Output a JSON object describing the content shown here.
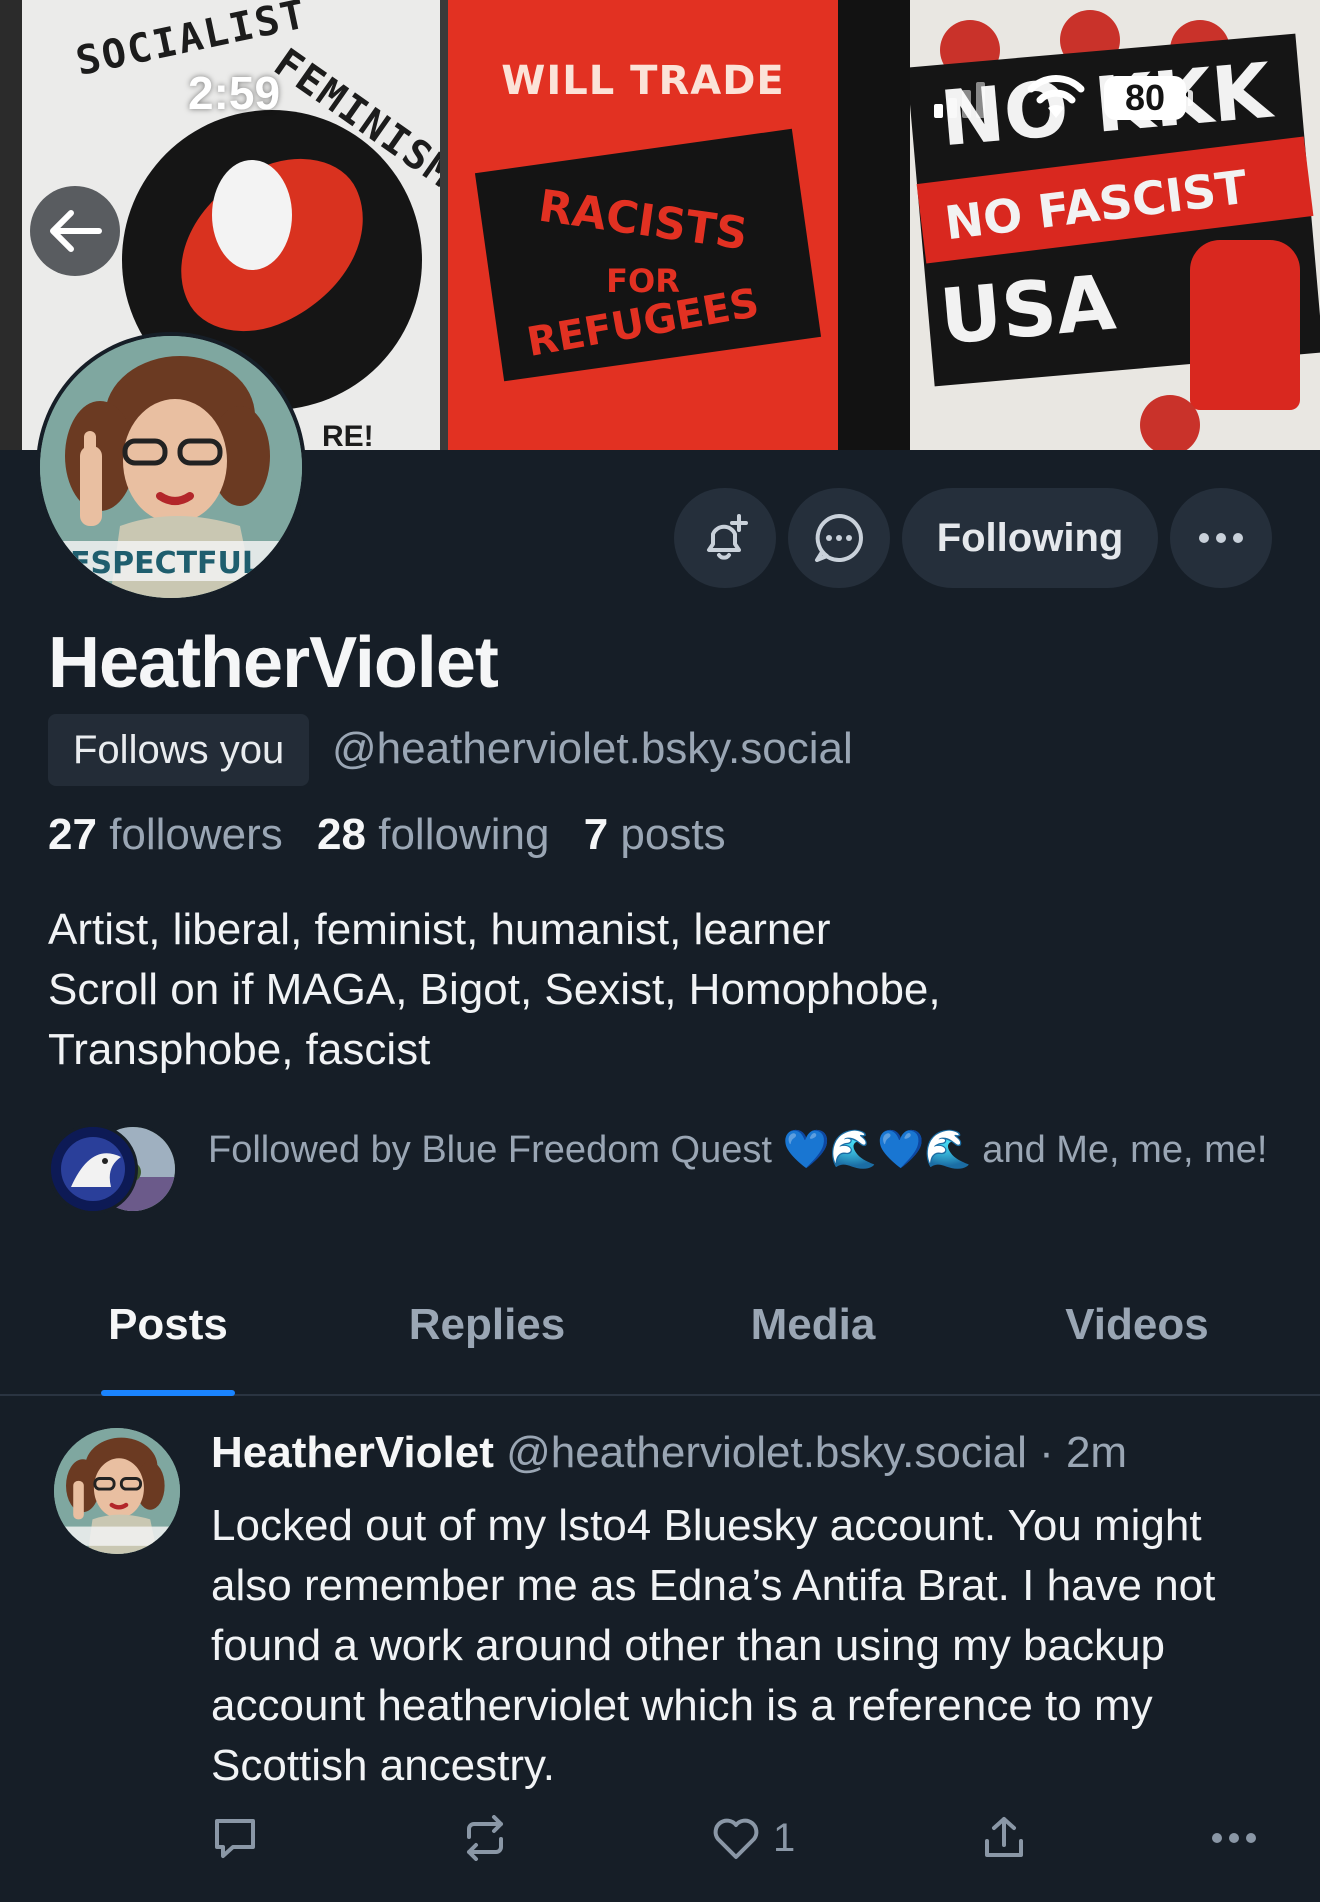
{
  "status_bar": {
    "time": "2:59",
    "battery": "80"
  },
  "banner": {
    "poster_left": {
      "line1": "SOCIALIST",
      "line2": "FEMINISM",
      "bottom": "RE!"
    },
    "poster_middle": {
      "line1": "WILL TRADE",
      "line2": "RACISTS",
      "line3": "FOR",
      "line4": "REFUGEES"
    },
    "poster_right": {
      "line1": "NO KKK",
      "line2": "NO FASCIST",
      "line3": "USA"
    }
  },
  "avatar_caption": "ESPECTFUL",
  "actions": {
    "following_label": "Following"
  },
  "profile": {
    "display_name": "HeatherViolet",
    "follows_you": "Follows you",
    "handle": "@heatherviolet.bsky.social",
    "followers_count": "27",
    "followers_label": "followers",
    "following_count": "28",
    "following_label": "following",
    "posts_count": "7",
    "posts_label": "posts",
    "bio": [
      "Artist, liberal, feminist, humanist, learner",
      "Scroll on if MAGA, Bigot, Sexist, Homophobe,",
      "Transphobe, fascist"
    ],
    "followed_by": "Followed by Blue Freedom Quest 💙🌊💙🌊 and Me, me, me!"
  },
  "tabs": [
    "Posts",
    "Replies",
    "Media",
    "Videos"
  ],
  "post": {
    "author": "HeatherViolet",
    "meta": "@heatherviolet.bsky.social · 2m",
    "text": "Locked out of my lsto4 Bluesky account. You might also remember me as Edna’s Antifa Brat. I have not found a work around other than using my backup account heatherviolet which is a reference to my Scottish ancestry.",
    "like_count": "1"
  },
  "colors": {
    "background": "#161e27",
    "button_bg": "#252f3b",
    "secondary_text": "#9aa6b4",
    "accent": "#1a84ff"
  }
}
